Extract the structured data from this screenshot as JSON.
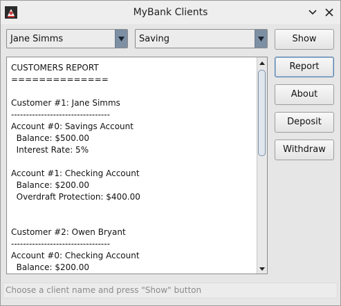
{
  "window": {
    "title": "MyBank Clients",
    "icon": "app-icon",
    "controls": [
      "minimize-icon",
      "close-icon"
    ]
  },
  "client_combo": {
    "selected": "Jane Simms",
    "icon": "chevron-down-icon"
  },
  "account_combo": {
    "selected": "Saving",
    "icon": "chevron-down-icon"
  },
  "buttons": {
    "show": "Show",
    "report": "Report",
    "about": "About",
    "deposit": "Deposit",
    "withdraw": "Withdraw"
  },
  "report_text": "CUSTOMERS REPORT\n==============\n\nCustomer #1: Jane Simms\n---------------------------------\nAccount #0: Savings Account\n  Balance: $500.00\n  Interest Rate: 5%\n\nAccount #1: Checking Account\n  Balance: $200.00\n  Overdraft Protection: $400.00\n\n\nCustomer #2: Owen Bryant\n---------------------------------\nAccount #0: Checking Account\n  Balance: $200.00",
  "status": {
    "placeholder": "Choose a client name and press \"Show\" button"
  },
  "colors": {
    "accent": "#7d8fa3",
    "focus": "#5a7fa8"
  }
}
